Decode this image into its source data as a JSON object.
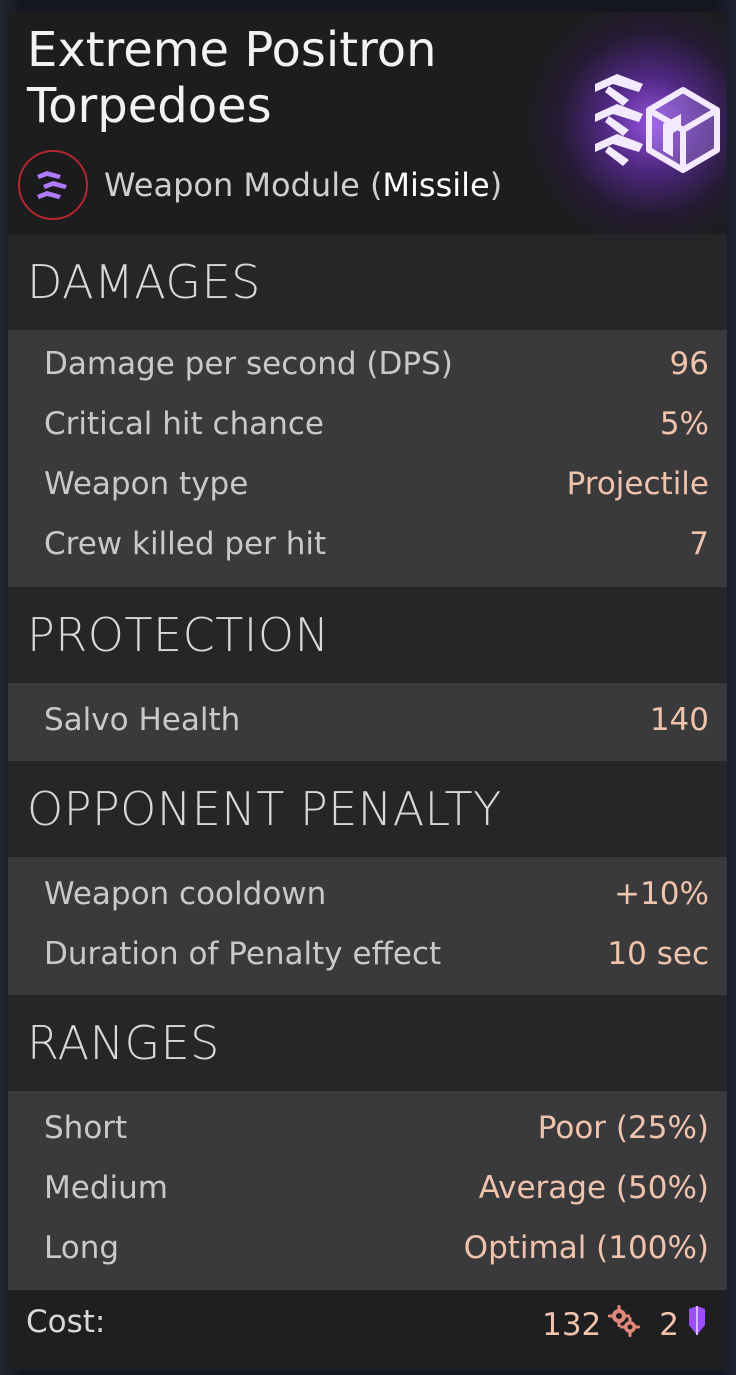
{
  "item": {
    "title_line1": "Extreme Positron",
    "title_line2": "Torpedoes",
    "class_prefix": "Weapon Module (",
    "class_highlight": "Missile",
    "class_suffix": ")",
    "class_icon": "missile-icon",
    "hero_icon": "missile-module-icon",
    "accent_color": "#9b4dff"
  },
  "sections": {
    "damages": {
      "title": "DAMAGES",
      "rows": [
        {
          "label": "Damage per second (DPS)",
          "value": "96"
        },
        {
          "label": "Critical hit chance",
          "value": "5%"
        },
        {
          "label": "Weapon type",
          "value": "Projectile"
        },
        {
          "label": "Crew killed per hit",
          "value": "7"
        }
      ]
    },
    "protection": {
      "title": "PROTECTION",
      "rows": [
        {
          "label": "Salvo Health",
          "value": "140"
        }
      ]
    },
    "penalty": {
      "title": "OPPONENT PENALTY",
      "rows": [
        {
          "label": "Weapon cooldown",
          "value": "+10%"
        },
        {
          "label": "Duration of Penalty effect",
          "value": "10 sec"
        }
      ]
    },
    "ranges": {
      "title": "RANGES",
      "rows": [
        {
          "label": "Short",
          "value": "Poor (25%)"
        },
        {
          "label": "Medium",
          "value": "Average (50%)"
        },
        {
          "label": "Long",
          "value": "Optimal (100%)"
        }
      ]
    }
  },
  "cost": {
    "label": "Cost:",
    "parts_amount": "132",
    "parts_icon": "gears-icon",
    "crystal_amount": "2",
    "crystal_icon": "crystal-icon",
    "value_color": "#f0c3ad",
    "crystal_color": "#9b4dff"
  }
}
